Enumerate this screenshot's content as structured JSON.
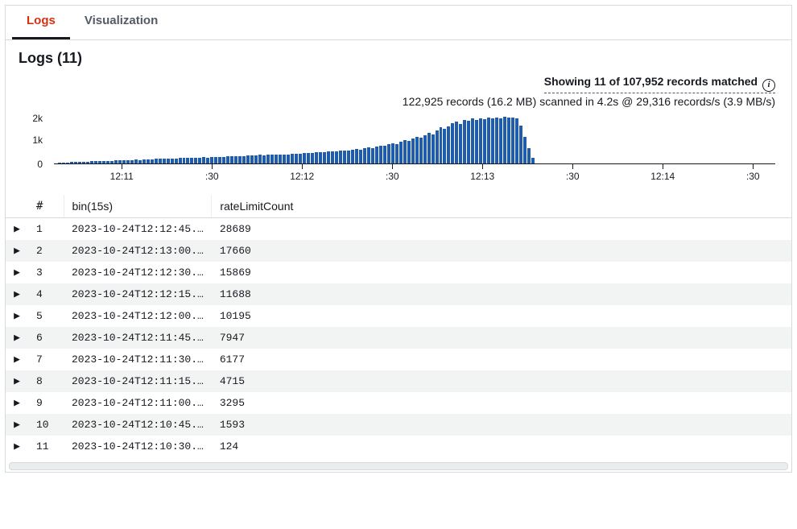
{
  "tabs": {
    "logs": "Logs",
    "visualization": "Visualization"
  },
  "section_title": "Logs (11)",
  "summary": {
    "line1": "Showing 11 of 107,952 records matched",
    "line2": "122,925 records (16.2 MB) scanned in 4.2s @ 29,316 records/s (3.9 MB/s)"
  },
  "columns": {
    "num": "#",
    "bin": "bin(15s)",
    "rate": "rateLimitCount"
  },
  "rows": [
    {
      "n": "1",
      "bin": "2023-10-24T12:12:45.…",
      "rate": "28689"
    },
    {
      "n": "2",
      "bin": "2023-10-24T12:13:00.…",
      "rate": "17660"
    },
    {
      "n": "3",
      "bin": "2023-10-24T12:12:30.…",
      "rate": "15869"
    },
    {
      "n": "4",
      "bin": "2023-10-24T12:12:15.…",
      "rate": "11688"
    },
    {
      "n": "5",
      "bin": "2023-10-24T12:12:00.…",
      "rate": "10195"
    },
    {
      "n": "6",
      "bin": "2023-10-24T12:11:45.…",
      "rate": "7947"
    },
    {
      "n": "7",
      "bin": "2023-10-24T12:11:30.…",
      "rate": "6177"
    },
    {
      "n": "8",
      "bin": "2023-10-24T12:11:15.…",
      "rate": "4715"
    },
    {
      "n": "9",
      "bin": "2023-10-24T12:11:00.…",
      "rate": "3295"
    },
    {
      "n": "10",
      "bin": "2023-10-24T12:10:45.…",
      "rate": "1593"
    },
    {
      "n": "11",
      "bin": "2023-10-24T12:10:30.…",
      "rate": "124"
    }
  ],
  "chart_data": {
    "type": "bar",
    "title": "",
    "xlabel": "",
    "ylabel": "",
    "y_ticks": [
      "2k",
      "1k",
      "0"
    ],
    "ylim": [
      0,
      2500
    ],
    "x_ticks": [
      {
        "pos": 0.094,
        "label": "12:11"
      },
      {
        "pos": 0.219,
        "label": ":30"
      },
      {
        "pos": 0.344,
        "label": "12:12"
      },
      {
        "pos": 0.469,
        "label": ":30"
      },
      {
        "pos": 0.594,
        "label": "12:13"
      },
      {
        "pos": 0.719,
        "label": ":30"
      },
      {
        "pos": 0.844,
        "label": "12:14"
      },
      {
        "pos": 0.969,
        "label": ":30"
      }
    ],
    "values": [
      0,
      40,
      60,
      50,
      80,
      90,
      100,
      110,
      100,
      120,
      140,
      130,
      150,
      160,
      150,
      170,
      180,
      190,
      200,
      190,
      210,
      200,
      230,
      220,
      240,
      260,
      250,
      270,
      280,
      260,
      280,
      300,
      290,
      310,
      320,
      300,
      330,
      340,
      320,
      350,
      360,
      350,
      370,
      390,
      380,
      400,
      410,
      400,
      430,
      420,
      440,
      460,
      450,
      470,
      480,
      460,
      480,
      500,
      490,
      520,
      540,
      520,
      550,
      570,
      560,
      590,
      610,
      600,
      640,
      660,
      630,
      680,
      700,
      690,
      730,
      760,
      740,
      800,
      840,
      820,
      900,
      950,
      930,
      1010,
      1080,
      1040,
      1150,
      1230,
      1180,
      1320,
      1420,
      1360,
      1500,
      1620,
      1550,
      1750,
      1900,
      1820,
      1980,
      2120,
      2220,
      2100,
      2300,
      2250,
      2380,
      2320,
      2400,
      2360,
      2420,
      2380,
      2440,
      2400,
      2450,
      2410,
      2440,
      2400,
      2000,
      1400,
      800,
      300,
      0,
      0,
      0,
      0,
      0,
      0,
      0,
      0,
      0,
      0,
      0,
      0,
      0,
      0,
      0,
      0,
      0,
      0,
      0,
      0,
      0,
      0,
      0,
      0,
      0,
      0,
      0,
      0,
      0,
      0,
      0,
      0,
      0,
      0,
      0,
      0,
      0,
      0,
      0,
      0,
      0,
      0,
      0,
      0,
      0,
      0,
      0,
      0,
      0,
      0,
      0,
      0,
      0,
      0,
      0,
      0,
      0,
      0,
      0,
      0
    ]
  }
}
